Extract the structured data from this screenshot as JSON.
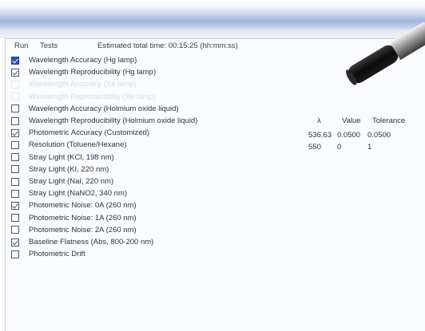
{
  "header": {
    "run_label": "Run",
    "tests_label": "Tests",
    "estimated_time": "Estimated total time: 00:15:25 (hh:mm:ss)"
  },
  "columns": {
    "lambda_label": "λ",
    "value_label": "Value",
    "tolerance_label": "Tolerance"
  },
  "tests": [
    {
      "label": "Wavelength Accuracy (Hg lamp)",
      "checked": true,
      "selected": true,
      "disabled": false
    },
    {
      "label": "Wavelength Reproducibility (Hg lamp)",
      "checked": true,
      "selected": false,
      "disabled": false
    },
    {
      "label": "Wavelength Accuracy (Xe lamp)",
      "checked": false,
      "selected": false,
      "disabled": true
    },
    {
      "label": "Wavelength Reproducibility (Xe lamp)",
      "checked": false,
      "selected": false,
      "disabled": true
    },
    {
      "label": "Wavelength Accuracy (Holmium oxide liquid)",
      "checked": false,
      "selected": false,
      "disabled": false
    },
    {
      "label": "Wavelength Reproducibility (Holmium oxide liquid)",
      "checked": false,
      "selected": false,
      "disabled": false
    },
    {
      "label": "Photometric Accuracy (Customized)",
      "checked": true,
      "selected": false,
      "disabled": false
    },
    {
      "label": "Resolution (Toluene/Hexane)",
      "checked": false,
      "selected": false,
      "disabled": false
    },
    {
      "label": "Stray Light (KCl, 198 nm)",
      "checked": false,
      "selected": false,
      "disabled": false
    },
    {
      "label": "Stray Light (KI, 220 nm)",
      "checked": false,
      "selected": false,
      "disabled": false
    },
    {
      "label": "Stray Light (NaI, 220 nm)",
      "checked": false,
      "selected": false,
      "disabled": false
    },
    {
      "label": "Stray Light (NaNO2, 340 nm)",
      "checked": false,
      "selected": false,
      "disabled": false
    },
    {
      "label": "Photometric Noise: 0A (260 nm)",
      "checked": true,
      "selected": false,
      "disabled": false
    },
    {
      "label": "Photometric Noise: 1A (260 nm)",
      "checked": false,
      "selected": false,
      "disabled": false
    },
    {
      "label": "Photometric Noise: 2A (260 nm)",
      "checked": false,
      "selected": false,
      "disabled": false
    },
    {
      "label": "Baseline Flatness (Abs, 800-200 nm)",
      "checked": true,
      "selected": false,
      "disabled": false
    },
    {
      "label": "Photometric Drift",
      "checked": false,
      "selected": false,
      "disabled": false
    }
  ],
  "params": [
    {
      "lambda": "536.63",
      "value": "0.0500",
      "tolerance": "0.0500"
    },
    {
      "lambda": "550",
      "value": "0",
      "tolerance": "1"
    }
  ]
}
